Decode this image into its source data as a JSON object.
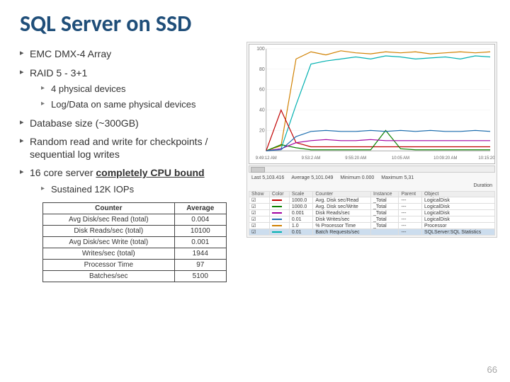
{
  "title": "SQL Server on SSD",
  "bullets": {
    "b1": "EMC DMX-4 Array",
    "b2": "RAID 5 - 3+1",
    "b2s1": "4 physical devices",
    "b2s2": "Log/Data on same physical devices",
    "b3": "Database size (~300GB)",
    "b4": "Random read and write for checkpoints / sequential log writes",
    "b5_pre": "16 core server ",
    "b5_em": "completely CPU bound",
    "b5s1": "Sustained 12K IOPs"
  },
  "table": {
    "h_counter": "Counter",
    "h_avg": "Average",
    "rows": [
      {
        "c": "Avg Disk/sec Read (total)",
        "v": "0.004"
      },
      {
        "c": "Disk Reads/sec (total)",
        "v": "10100"
      },
      {
        "c": "Avg Disk/sec Write (total)",
        "v": "0.001"
      },
      {
        "c": "Writes/sec (total)",
        "v": "1944"
      },
      {
        "c": "Processor Time",
        "v": "97"
      },
      {
        "c": "Batches/sec",
        "v": "5100"
      }
    ]
  },
  "perfmon": {
    "toolbar": {
      "show": "Show",
      "color": "Color",
      "scale": "Scale",
      "counter": "Counter",
      "instance": "Instance",
      "parent": "Parent",
      "object": "Object"
    },
    "stats": {
      "last_l": "Last",
      "last_v": "5,103.416",
      "avg_l": "Average",
      "avg_v": "5,101.049",
      "min_l": "Minimum",
      "min_v": "0.000",
      "max_l": "Maximum",
      "max_v": "5,31",
      "dur_l": "Duration"
    },
    "y_ticks": [
      "20",
      "40",
      "60",
      "80",
      "100"
    ],
    "x_ticks": [
      "9:49:12 AM",
      "9:53:2 AM",
      "9:55:20 AM",
      "10:05 AM",
      "10:09:20 AM",
      "10:15:20 AM"
    ],
    "legend": [
      {
        "color": "#c00000",
        "scale": "1000.0",
        "counter": "Avg. Disk sec/Read",
        "instance": "_Total",
        "object": "LogicalDisk"
      },
      {
        "color": "#0b8000",
        "scale": "1000.0",
        "counter": "Avg. Disk sec/Write",
        "instance": "_Total",
        "object": "LogicalDisk"
      },
      {
        "color": "#a000a0",
        "scale": "0.001",
        "counter": "Disk Reads/sec",
        "instance": "_Total",
        "object": "LogicalDisk"
      },
      {
        "color": "#1f6fb0",
        "scale": "0.01",
        "counter": "Disk Writes/sec",
        "instance": "_Total",
        "object": "LogicalDisk"
      },
      {
        "color": "#d08000",
        "scale": "1.0",
        "counter": "% Processor Time",
        "instance": "_Total",
        "object": "Processor"
      },
      {
        "color": "#00b0b0",
        "scale": "0.01",
        "counter": "Batch Requests/sec",
        "instance": "",
        "object": "SQLServer:SQL Statistics"
      }
    ]
  },
  "chart_data": {
    "type": "line",
    "title": "",
    "xlabel": "",
    "ylabel": "",
    "ylim": [
      0,
      100
    ],
    "x": [
      0,
      1,
      2,
      3,
      4,
      5,
      6,
      7,
      8,
      9,
      10,
      11,
      12,
      13,
      14,
      15
    ],
    "series": [
      {
        "name": "% Processor Time (_Total)",
        "color": "#d08000",
        "values": [
          0,
          5,
          90,
          97,
          94,
          98,
          96,
          95,
          97,
          96,
          97,
          95,
          96,
          97,
          96,
          97
        ]
      },
      {
        "name": "Batch Requests/sec (x0.01)",
        "color": "#00b0b0",
        "values": [
          0,
          2,
          45,
          85,
          88,
          90,
          92,
          90,
          93,
          92,
          90,
          91,
          92,
          90,
          93,
          92
        ]
      },
      {
        "name": "Avg Disk sec/Read (x1000)",
        "color": "#c00000",
        "values": [
          0,
          40,
          8,
          4,
          4,
          4,
          4,
          4,
          4,
          4,
          4,
          4,
          4,
          4,
          4,
          4
        ]
      },
      {
        "name": "Avg Disk sec/Write (x1000)",
        "color": "#0b8000",
        "values": [
          0,
          6,
          3,
          1,
          1,
          1,
          1,
          1,
          20,
          2,
          1,
          1,
          1,
          1,
          1,
          1
        ]
      },
      {
        "name": "Disk Reads/sec (x0.001)",
        "color": "#a000a0",
        "values": [
          0,
          2,
          8,
          10,
          11,
          10,
          10,
          11,
          10,
          10,
          10,
          10,
          10,
          10,
          10,
          10
        ]
      },
      {
        "name": "Disk Writes/sec (x0.01)",
        "color": "#1f6fb0",
        "values": [
          0,
          1,
          14,
          19,
          20,
          19,
          19,
          20,
          19,
          20,
          19,
          20,
          19,
          19,
          20,
          19
        ]
      }
    ]
  },
  "slide_number": "66"
}
